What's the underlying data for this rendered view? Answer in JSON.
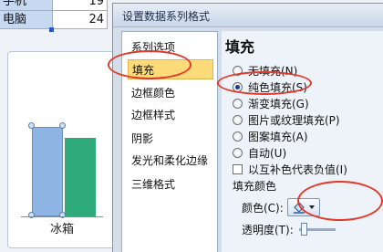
{
  "sheet": {
    "rows": [
      {
        "label": "手机",
        "value": "19"
      },
      {
        "label": "电脑",
        "value": "24"
      }
    ]
  },
  "chart": {
    "category_label": "冰箱"
  },
  "chart_data": {
    "type": "bar",
    "categories": [
      "冰箱"
    ],
    "series": [
      {
        "values": [
          90
        ]
      },
      {
        "values": [
          79
        ]
      }
    ],
    "colors": [
      "#8eb4e3",
      "#2eaa7b"
    ]
  },
  "dialog": {
    "title": "设置数据系列格式",
    "nav_items": [
      {
        "label": "系列选项",
        "active": false
      },
      {
        "label": "填充",
        "active": true
      },
      {
        "label": "边框颜色",
        "active": false
      },
      {
        "label": "边框样式",
        "active": false
      },
      {
        "label": "阴影",
        "active": false
      },
      {
        "label": "发光和柔化边缘",
        "active": false
      },
      {
        "label": "三维格式",
        "active": false
      }
    ],
    "section_title": "填充",
    "fill_options": [
      {
        "label": "无填充(N)",
        "checked": false
      },
      {
        "label": "纯色填充(S)",
        "checked": true
      },
      {
        "label": "渐变填充(G)",
        "checked": false
      },
      {
        "label": "图片或纹理填充(P)",
        "checked": false
      },
      {
        "label": "图案填充(A)",
        "checked": false
      },
      {
        "label": "自动(U)",
        "checked": false
      }
    ],
    "invert_checkbox": {
      "label": "以互补色代表负值(I)",
      "checked": false
    },
    "fill_color_group": {
      "title": "填充颜色",
      "color_label": "颜色(C):",
      "transparency_label": "透明度(T):"
    }
  },
  "colors": {
    "annotation": "#e23a2a",
    "active_nav": "#fdda7a"
  }
}
